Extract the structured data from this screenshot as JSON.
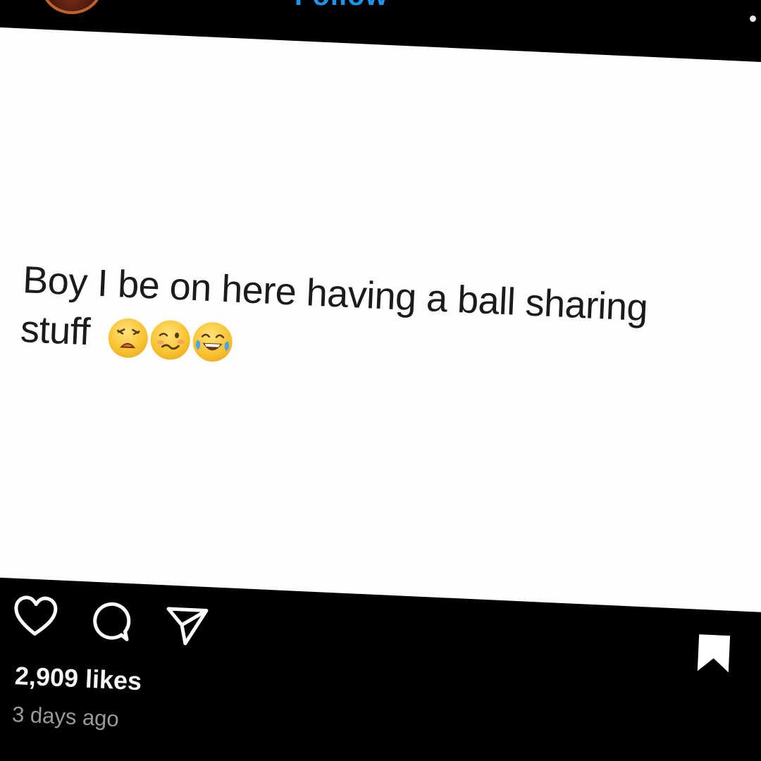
{
  "header": {
    "follow_label": "Follow",
    "avatar_icon": "profile-avatar",
    "more_icon": "more-options-icon"
  },
  "post": {
    "caption_line1": "Boy I be on here having a ball sharing",
    "caption_line2": "stuff",
    "emojis": [
      "weary-face",
      "woozy-face",
      "face-with-tears-of-joy"
    ]
  },
  "actions": {
    "like_icon": "heart-icon",
    "comment_icon": "comment-icon",
    "share_icon": "share-icon",
    "save_icon": "bookmark-icon"
  },
  "stats": {
    "likes": "2,909 likes",
    "time": "3 days ago"
  },
  "colors": {
    "background": "#000000",
    "card": "#fefefe",
    "accent": "#1b95f0",
    "muted_text": "#9a9a9a"
  }
}
